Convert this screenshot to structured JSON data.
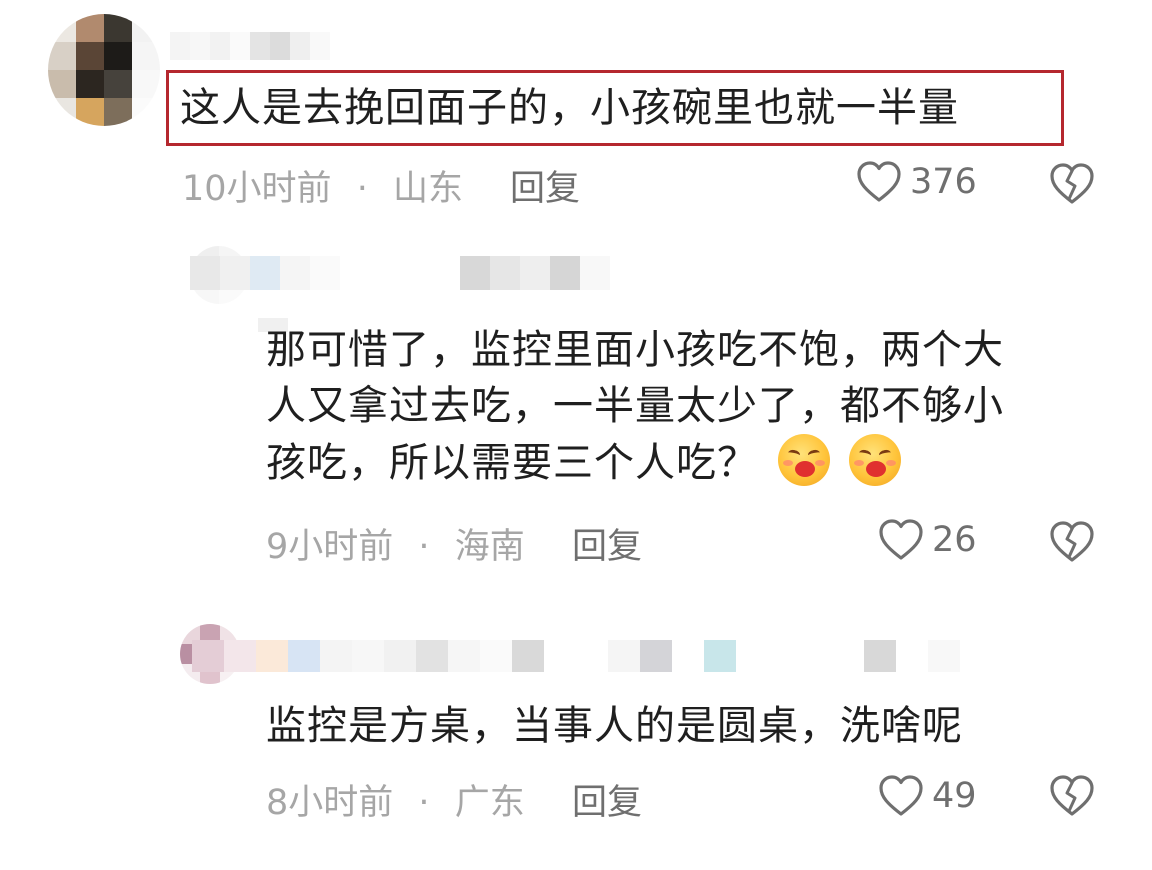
{
  "colors": {
    "highlight_border": "#b5282e",
    "meta_gray": "#a6a6a6",
    "action_gray": "#6f6f6f",
    "text": "#1f1f1f"
  },
  "comments": [
    {
      "text": "这人是去挽回面子的，小孩碗里也就一半量",
      "time": "10小时前",
      "separator": "·",
      "region": "山东",
      "reply_label": "回复",
      "likes": "376",
      "icons": {
        "like": "heart-outline-icon",
        "dislike": "broken-heart-icon"
      }
    },
    {
      "text_lines": [
        "那可惜了，监控里面小孩吃不饱，两个大",
        "人又拿过去吃，一半量太少了，都不够小",
        "孩吃，所以需要三个人吃？"
      ],
      "emojis": [
        "kiss-face-emoji",
        "kiss-face-emoji"
      ],
      "time": "9小时前",
      "separator": "·",
      "region": "海南",
      "reply_label": "回复",
      "likes": "26",
      "icons": {
        "like": "heart-outline-icon",
        "dislike": "broken-heart-icon"
      }
    },
    {
      "text": "监控是方桌，当事人的是圆桌，洗啥呢",
      "time": "8小时前",
      "separator": "·",
      "region": "广东",
      "reply_label": "回复",
      "likes": "49",
      "icons": {
        "like": "heart-outline-icon",
        "dislike": "broken-heart-icon"
      }
    }
  ]
}
